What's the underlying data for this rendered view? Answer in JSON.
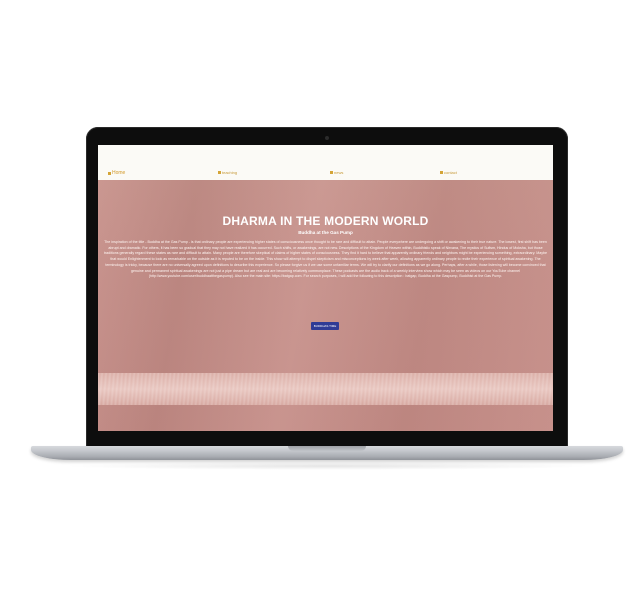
{
  "nav": {
    "items": [
      {
        "label": "Home",
        "icon": "home-icon"
      },
      {
        "label": "teaching",
        "icon": "page-icon"
      },
      {
        "label": "news",
        "icon": "page-icon"
      },
      {
        "label": "contact",
        "icon": "page-icon"
      }
    ]
  },
  "hero": {
    "title": "DHARMA IN THE MODERN WORLD",
    "subtitle": "Buddha at the Gas Pump",
    "body": "The inspiration of the title - Buddha at the Gas Pump - is that ordinary people are experiencing higher states of consciousness once thought to be rare and difficult to attain. People everywhere are undergoing a shift or awakening to their true nature. The lowest, first shift has been abrupt and dramatic. For others, it has been so gradual that they may not have realized it has occurred. Such shifts, or awakenings, are not new. Descriptions of the Kingdom of Heaven within, Buddhistic speak of Nirvana, The mystics of Sufism, Hindus of Moksha, but those traditions generally regard these states as rare and difficult to attain. Many people are therefore skeptical of claims of higher states of consciousness. They find it hard to believe that apparently ordinary friends and neighbors might be experiencing something, extraordinary. Maybe that would Enlightenment to look as remarkable on the outside as it is reputed to be on the inside. This show will attempt to dispel skepticism and misconceptions by week after week, allowing apparently ordinary people to recite their experience of spiritual awakening. The terminology is tricky, because there are no universally agreed upon definitions to describe this experience. So please forgive us if we use some unfamiliar terms. We will try to clarify our definitions as we go along. Perhaps, after a while, those listening will become convinced that genuine and permanent spiritual awakenings are not just a pipe dream but are real and are becoming relatively commonplace. These podcasts are the audio track of a weekly interview show which may be seen as videos on our YouTube channel (http://www.youtube.com/user/buddhaatthegaspump). Also see the main site: https://batgap.com. For search purposes, I will add the following to this description : batgap, Buddha at the Gaspump, Buddhist at the Gas Pump.",
    "cta_label": "BUDDHAS TIME"
  },
  "colors": {
    "nav_bg": "#fbfaf6",
    "nav_text": "#c79a3a",
    "content_bg": "#c7918a",
    "button_bg": "#2f3b96",
    "bezel": "#0d0d0d"
  }
}
